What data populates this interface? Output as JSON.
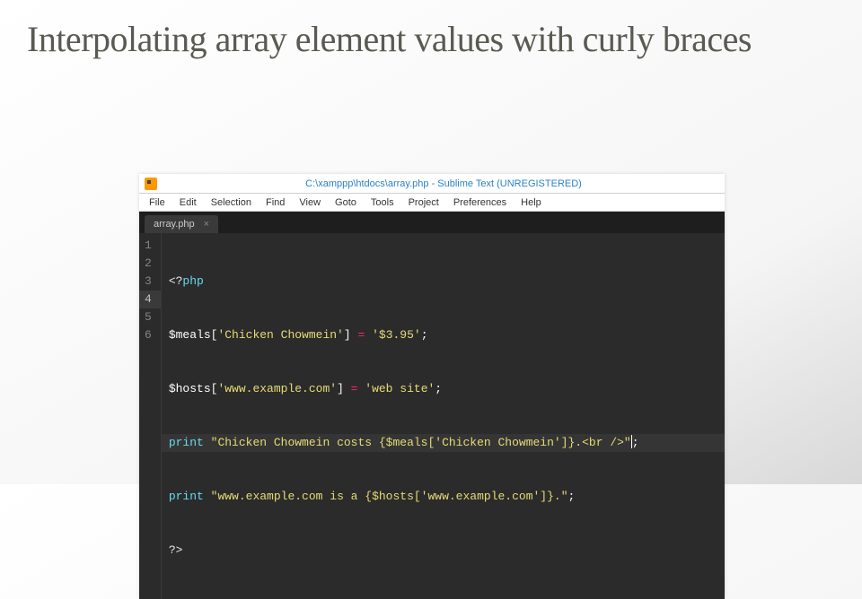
{
  "slide": {
    "title": "Interpolating array element values with curly braces"
  },
  "editor": {
    "window_title": "C:\\xamppp\\htdocs\\array.php - Sublime Text (UNREGISTERED)",
    "menu": [
      "File",
      "Edit",
      "Selection",
      "Find",
      "View",
      "Goto",
      "Tools",
      "Project",
      "Preferences",
      "Help"
    ],
    "tab": {
      "label": "array.php",
      "close": "×"
    },
    "line_numbers": [
      "1",
      "2",
      "3",
      "4",
      "5",
      "6"
    ],
    "active_line_index": 3,
    "code": {
      "l1": {
        "open": "<?",
        "kw": "php"
      },
      "l2": {
        "var": "$meals",
        "b1": "[",
        "key": "'Chicken Chowmein'",
        "b2": "]",
        "eq": " = ",
        "val": "'$3.95'",
        "end": ";"
      },
      "l3": {
        "var": "$hosts",
        "b1": "[",
        "key": "'www.example.com'",
        "b2": "]",
        "eq": " = ",
        "val": "'web site'",
        "end": ";"
      },
      "l4": {
        "kw": "print",
        "sp": " ",
        "str": "\"Chicken Chowmein costs {$meals['Chicken Chowmein']}.<br />\"",
        "end": ";"
      },
      "l5": {
        "kw": "print",
        "sp": " ",
        "str": "\"www.example.com is a {$hosts['www.example.com']}.\"",
        "end": ";"
      },
      "l6": {
        "close": "?>"
      }
    }
  }
}
